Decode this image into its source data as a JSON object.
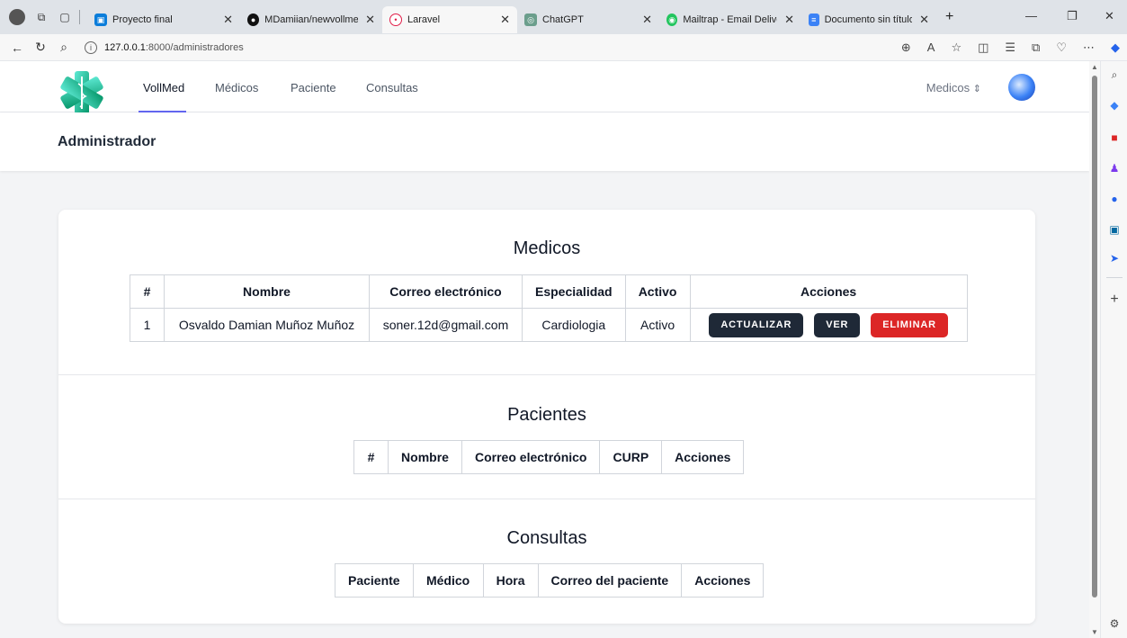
{
  "browser": {
    "tabs": [
      {
        "title": "Proyecto final",
        "fav_color": "#0b7dda"
      },
      {
        "title": "MDamiian/newvollmed",
        "fav_color": "#111111"
      },
      {
        "title": "Laravel",
        "fav_color": "#e11d48"
      },
      {
        "title": "ChatGPT",
        "fav_color": "#6b9e8c"
      },
      {
        "title": "Mailtrap - Email Delivery",
        "fav_color": "#22c55e"
      },
      {
        "title": "Documento sin título - D",
        "fav_color": "#3b82f6"
      }
    ],
    "url_host": "127.0.0.1",
    "url_path": ":8000/administradores"
  },
  "nav": {
    "brand": "VollMed",
    "links": [
      "Médicos",
      "Paciente",
      "Consultas"
    ],
    "user_menu": "Medicos"
  },
  "page": {
    "title": "Administrador"
  },
  "medicos": {
    "title": "Medicos",
    "headers": [
      "#",
      "Nombre",
      "Correo electrónico",
      "Especialidad",
      "Activo",
      "Acciones"
    ],
    "rows": [
      {
        "id": "1",
        "nombre": "Osvaldo Damian Muñoz Muñoz",
        "correo": "soner.12d@gmail.com",
        "especialidad": "Cardiologia",
        "activo": "Activo"
      }
    ],
    "actions": {
      "update": "ACTUALIZAR",
      "view": "VER",
      "delete": "ELIMINAR"
    }
  },
  "pacientes": {
    "title": "Pacientes",
    "headers": [
      "#",
      "Nombre",
      "Correo electrónico",
      "CURP",
      "Acciones"
    ]
  },
  "consultas": {
    "title": "Consultas",
    "headers": [
      "Paciente",
      "Médico",
      "Hora",
      "Correo del paciente",
      "Acciones"
    ]
  }
}
